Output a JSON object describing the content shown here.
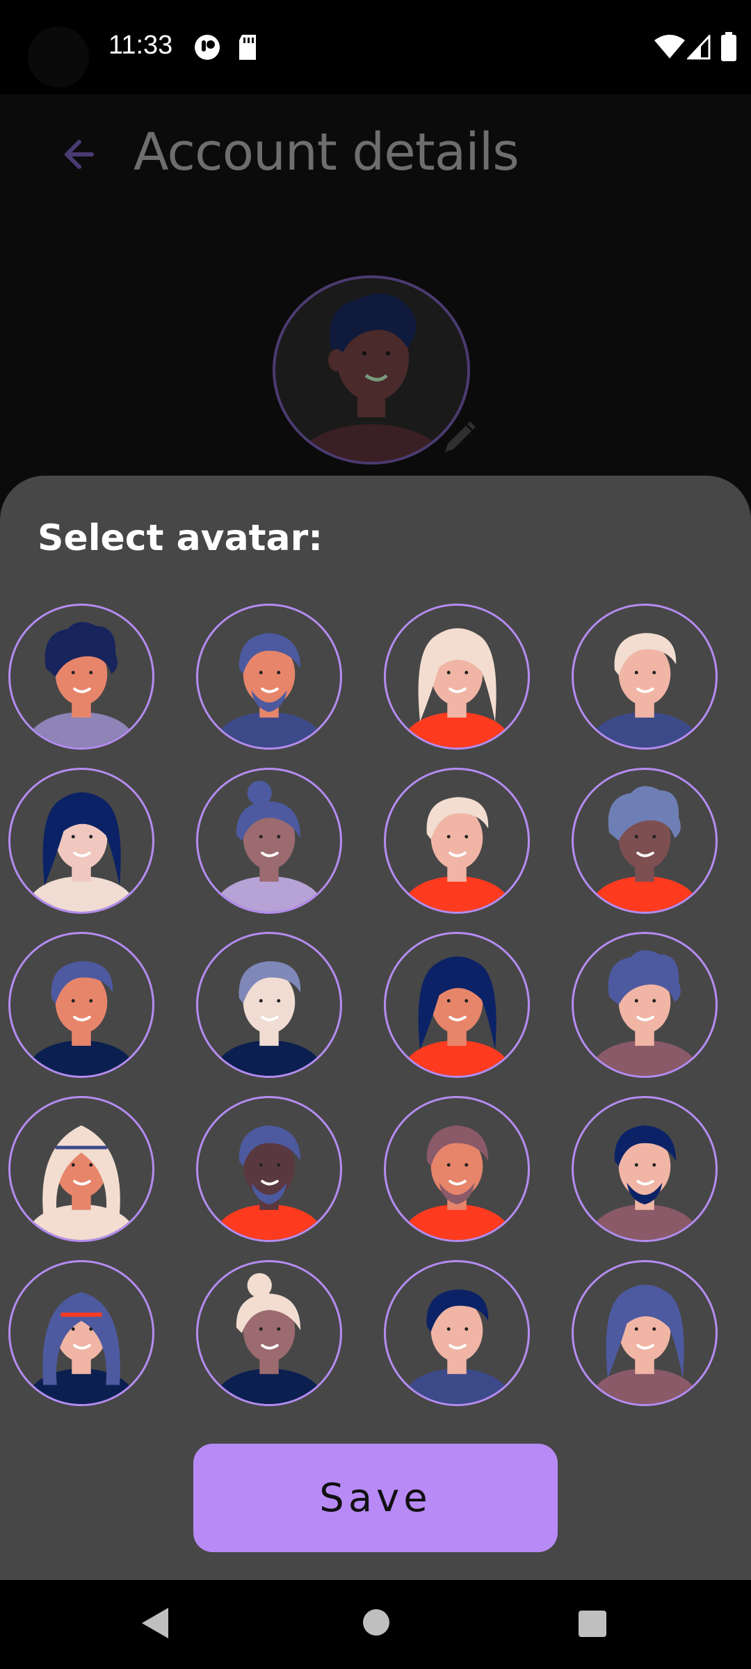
{
  "status_bar": {
    "time": "11:33",
    "icons": [
      "notification-icon",
      "sd-card-icon",
      "wifi-icon",
      "signal-icon",
      "battery-icon"
    ]
  },
  "app_bar": {
    "title": "Account details",
    "back_icon": "arrow-back-icon"
  },
  "current_avatar": {
    "edit_icon": "pencil-icon"
  },
  "sheet": {
    "title": "Select avatar:",
    "save_label": "Save"
  },
  "avatars": [
    {
      "skin": "#e7856b",
      "hair": "#18245c",
      "shirt": "#8f84b8",
      "style": "curly"
    },
    {
      "skin": "#e7856b",
      "hair": "#4d5aa0",
      "shirt": "#3d4a8a",
      "style": "beard"
    },
    {
      "skin": "#f0b5a5",
      "hair": "#f2ddd0",
      "shirt": "#ff3b1f",
      "style": "long"
    },
    {
      "skin": "#f0b5a5",
      "hair": "#f2ddd0",
      "shirt": "#3d4a8a",
      "style": "short"
    },
    {
      "skin": "#f0c8c0",
      "hair": "#0b2266",
      "shirt": "#f0dcd2",
      "style": "long"
    },
    {
      "skin": "#9b6b6f",
      "hair": "#4d5aa0",
      "shirt": "#b7a2d6",
      "style": "bun"
    },
    {
      "skin": "#f0b5a5",
      "hair": "#f2ddd0",
      "shirt": "#ff3b1f",
      "style": "short"
    },
    {
      "skin": "#7d4f51",
      "hair": "#6e7fb5",
      "shirt": "#ff3b1f",
      "style": "curly"
    },
    {
      "skin": "#e7856b",
      "hair": "#4d5aa0",
      "shirt": "#0b2050",
      "style": "short"
    },
    {
      "skin": "#f0dcd2",
      "hair": "#7f88b8",
      "shirt": "#0b2050",
      "style": "short"
    },
    {
      "skin": "#e7856b",
      "hair": "#0b2266",
      "shirt": "#ff3b1f",
      "style": "long"
    },
    {
      "skin": "#f0b5a5",
      "hair": "#4d5aa0",
      "shirt": "#8a5a68",
      "style": "curly"
    },
    {
      "skin": "#e7856b",
      "hair": "#f2ddd0",
      "shirt": "#f2ddd0",
      "style": "headwrap"
    },
    {
      "skin": "#5a3840",
      "hair": "#4d5aa0",
      "shirt": "#ff3b1f",
      "style": "beard"
    },
    {
      "skin": "#e7856b",
      "hair": "#8a5a68",
      "shirt": "#ff3b1f",
      "style": "beard"
    },
    {
      "skin": "#f0b5a5",
      "hair": "#0b2266",
      "shirt": "#8a5a68",
      "style": "beard"
    },
    {
      "skin": "#f0b5a5",
      "hair": "#4d5aa0",
      "shirt": "#0b2050",
      "style": "hijab"
    },
    {
      "skin": "#9b6b6f",
      "hair": "#f2ddd0",
      "shirt": "#0b2050",
      "style": "bun"
    },
    {
      "skin": "#f0b5a5",
      "hair": "#0b2266",
      "shirt": "#3d4a8a",
      "style": "short"
    },
    {
      "skin": "#f0b5a5",
      "hair": "#4d5aa0",
      "shirt": "#8a5a68",
      "style": "long"
    }
  ],
  "colors": {
    "accent": "#b88af6",
    "sheet_bg": "#474747",
    "avatar_border": "#b48cf0"
  }
}
